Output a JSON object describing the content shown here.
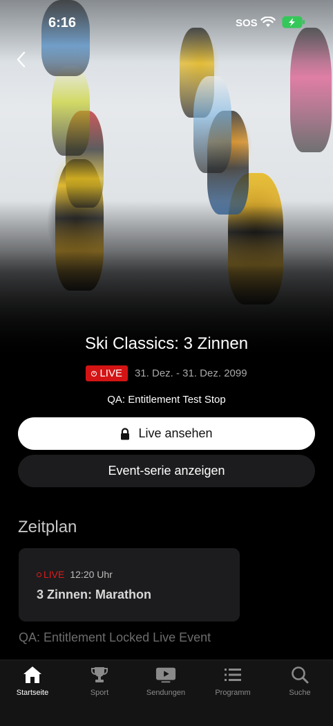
{
  "status_bar": {
    "time": "6:16",
    "sos": "SOS"
  },
  "event": {
    "title": "Ski Classics: 3 Zinnen",
    "live_label": "LIVE",
    "date_range": "31. Dez. - 31. Dez. 2099",
    "subtitle": "QA: Entitlement Test Stop"
  },
  "buttons": {
    "watch_label": "Live ansehen",
    "series_label": "Event-serie anzeigen"
  },
  "schedule": {
    "heading": "Zeitplan",
    "items": [
      {
        "live_label": "LIVE",
        "time": "12:20 Uhr",
        "title": "3 Zinnen: Marathon"
      }
    ],
    "footer_text": "QA: Entitlement Locked Live Event"
  },
  "tab_bar": {
    "tabs": [
      {
        "label": "Startseite",
        "icon": "home-icon",
        "active": true
      },
      {
        "label": "Sport",
        "icon": "trophy-icon",
        "active": false
      },
      {
        "label": "Sendungen",
        "icon": "play-icon",
        "active": false
      },
      {
        "label": "Programm",
        "icon": "list-icon",
        "active": false
      },
      {
        "label": "Suche",
        "icon": "search-icon",
        "active": false
      }
    ]
  },
  "colors": {
    "live_red": "#d41414",
    "background": "#000000",
    "surface": "#1c1c1e"
  }
}
